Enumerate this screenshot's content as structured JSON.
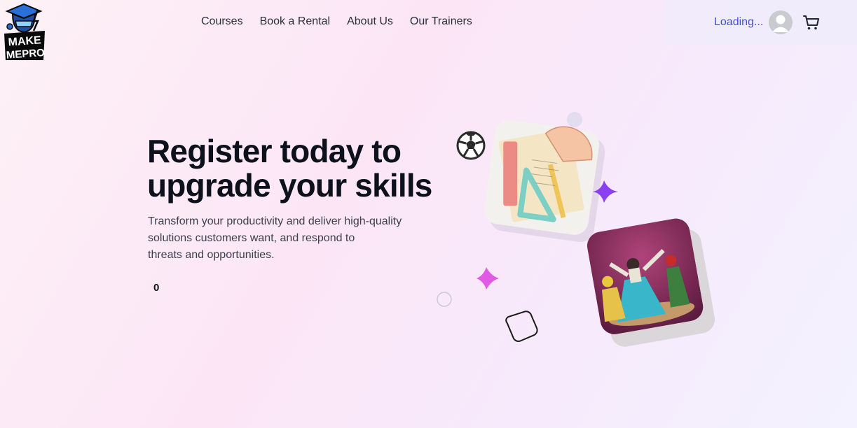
{
  "header": {
    "logo": {
      "icon": "make-me-pro-logo",
      "lines": [
        "MAKE",
        "MEPRO"
      ]
    },
    "nav": [
      {
        "label": "Courses"
      },
      {
        "label": "Book a Rental"
      },
      {
        "label": "About Us"
      },
      {
        "label": "Our Trainers"
      }
    ],
    "status_text": "Loading...",
    "avatar_icon": "user-avatar-icon",
    "cart_icon": "shopping-cart-icon"
  },
  "hero": {
    "title_lines": [
      "Register today to",
      "upgrade your skills"
    ],
    "subtitle_lines": [
      "Transform your productivity and deliver high-quality",
      "solutions customers want, and respond to",
      "threats and opportunities."
    ],
    "counter": "0"
  },
  "colors": {
    "accent": "#3f4fd8",
    "heading": "#0d111c",
    "sparkle_purple": "#8a3ff0",
    "sparkle_pink": "#e05ae6"
  }
}
